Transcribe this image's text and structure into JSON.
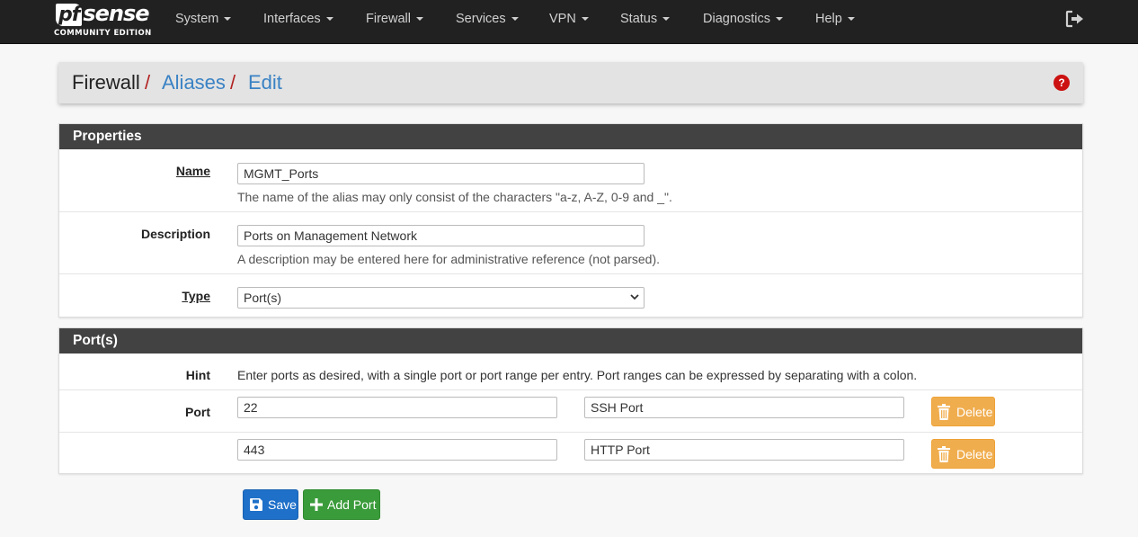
{
  "navbar": {
    "logo": {
      "brand": "sense",
      "brand_prefix": "pf",
      "edition": "COMMUNITY EDITION"
    },
    "menus": [
      "System",
      "Interfaces",
      "Firewall",
      "Services",
      "VPN",
      "Status",
      "Diagnostics",
      "Help"
    ]
  },
  "breadcrumb": {
    "root": "Firewall",
    "separator": "/",
    "items": [
      "Aliases",
      "Edit"
    ]
  },
  "properties": {
    "heading": "Properties",
    "name_label": "Name",
    "name_value": "MGMT_Ports",
    "name_help": "The name of the alias may only consist of the characters \"a-z, A-Z, 0-9 and _\".",
    "description_label": "Description",
    "description_value": "Ports on Management Network",
    "description_help": "A description may be entered here for administrative reference (not parsed).",
    "type_label": "Type",
    "type_value": "Port(s)"
  },
  "ports": {
    "heading": "Port(s)",
    "hint_label": "Hint",
    "hint_text": "Enter ports as desired, with a single port or port range per entry. Port ranges can be expressed by separating with a colon.",
    "port_label": "Port",
    "entries": [
      {
        "port": "22",
        "description": "SSH Port",
        "delete_label": "Delete"
      },
      {
        "port": "443",
        "description": "HTTP Port",
        "delete_label": "Delete"
      }
    ]
  },
  "actions": {
    "save_label": "Save",
    "add_port_label": "Add Port"
  },
  "colors": {
    "navbar": "#212121",
    "link": "#3a82c4",
    "separator": "#b22222",
    "warning": "#f0ad4e",
    "primary": "#1e70c9",
    "success": "#3a9b3a"
  }
}
